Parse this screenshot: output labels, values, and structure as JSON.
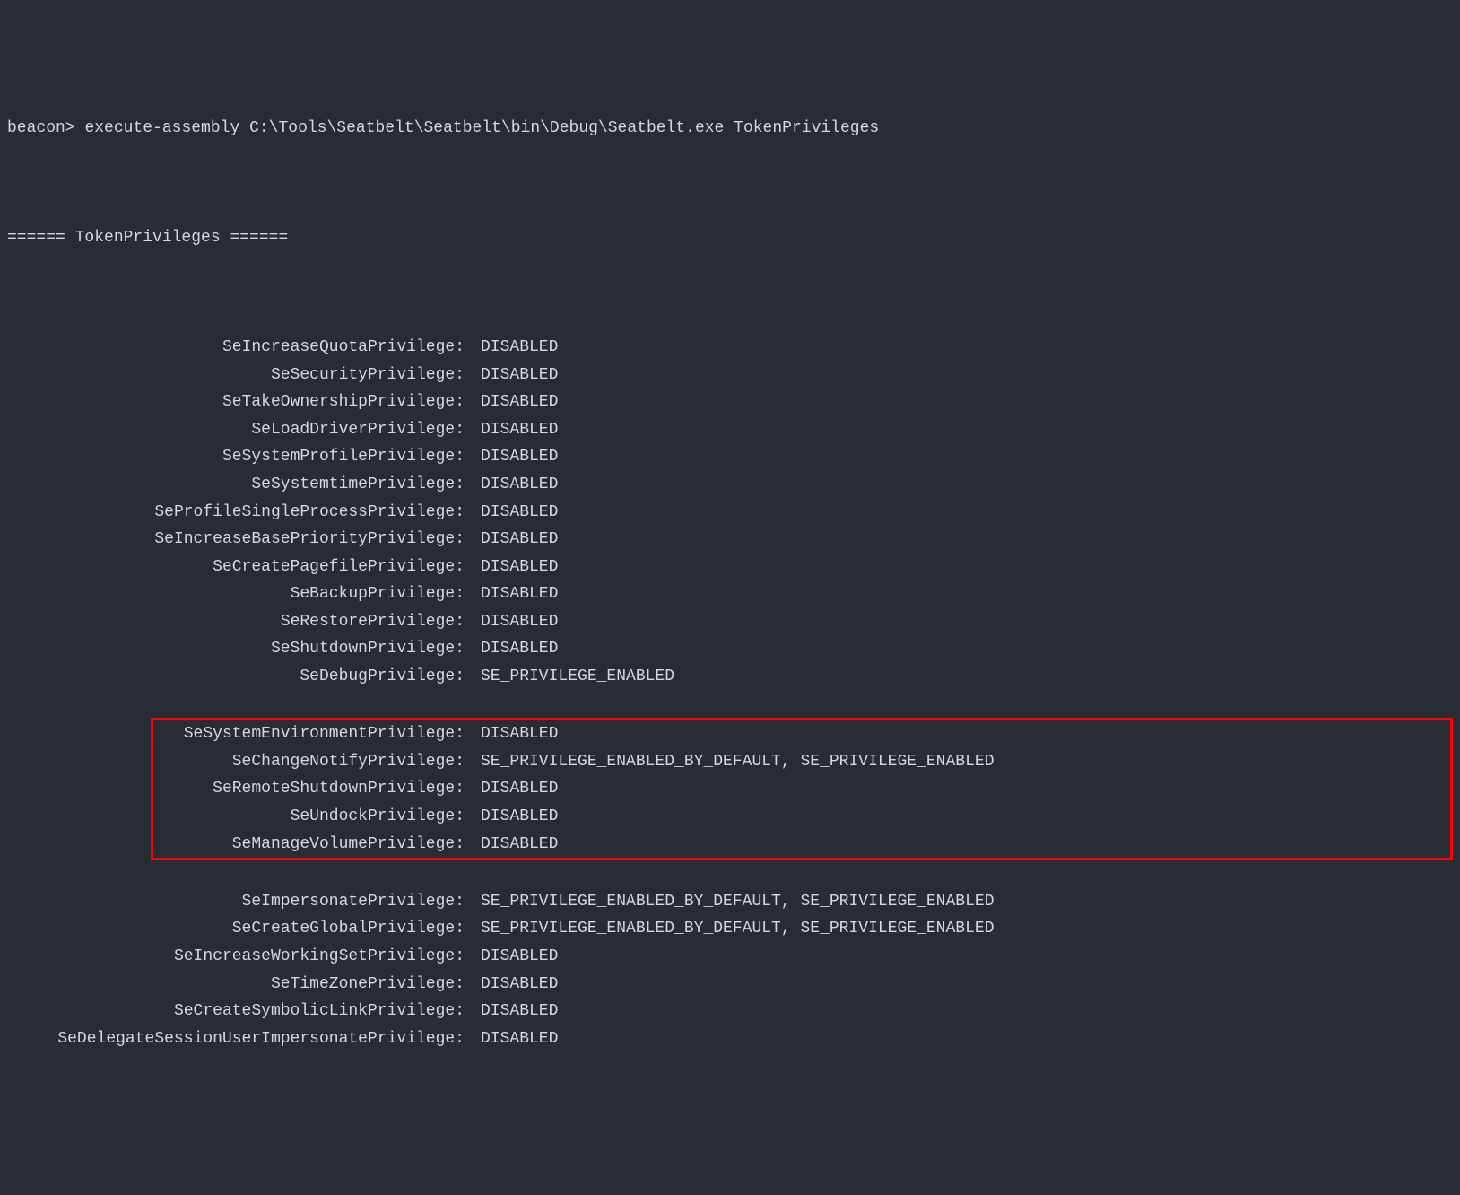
{
  "prompt_label": "beacon>",
  "command": "execute-assembly C:\\Tools\\Seatbelt\\Seatbelt\\bin\\Debug\\Seatbelt.exe TokenPrivileges",
  "section_header": "====== TokenPrivileges ======",
  "privileges_before": [
    {
      "name": "SeIncreaseQuotaPrivilege:",
      "value": "DISABLED"
    },
    {
      "name": "SeSecurityPrivilege:",
      "value": "DISABLED"
    },
    {
      "name": "SeTakeOwnershipPrivilege:",
      "value": "DISABLED"
    },
    {
      "name": "SeLoadDriverPrivilege:",
      "value": "DISABLED"
    },
    {
      "name": "SeSystemProfilePrivilege:",
      "value": "DISABLED"
    },
    {
      "name": "SeSystemtimePrivilege:",
      "value": "DISABLED"
    },
    {
      "name": "SeProfileSingleProcessPrivilege:",
      "value": "DISABLED"
    },
    {
      "name": "SeIncreaseBasePriorityPrivilege:",
      "value": "DISABLED"
    },
    {
      "name": "SeCreatePagefilePrivilege:",
      "value": "DISABLED"
    },
    {
      "name": "SeBackupPrivilege:",
      "value": "DISABLED"
    },
    {
      "name": "SeRestorePrivilege:",
      "value": "DISABLED"
    },
    {
      "name": "SeShutdownPrivilege:",
      "value": "DISABLED"
    },
    {
      "name": "SeDebugPrivilege:",
      "value": "SE_PRIVILEGE_ENABLED"
    }
  ],
  "privileges_highlighted": [
    {
      "name": "SeSystemEnvironmentPrivilege:",
      "value": "DISABLED"
    },
    {
      "name": "SeChangeNotifyPrivilege:",
      "value": "SE_PRIVILEGE_ENABLED_BY_DEFAULT, SE_PRIVILEGE_ENABLED"
    },
    {
      "name": "SeRemoteShutdownPrivilege:",
      "value": "DISABLED"
    },
    {
      "name": "SeUndockPrivilege:",
      "value": "DISABLED"
    },
    {
      "name": "SeManageVolumePrivilege:",
      "value": "DISABLED"
    }
  ],
  "privileges_after": [
    {
      "name": "SeImpersonatePrivilege:",
      "value": "SE_PRIVILEGE_ENABLED_BY_DEFAULT, SE_PRIVILEGE_ENABLED"
    },
    {
      "name": "SeCreateGlobalPrivilege:",
      "value": "SE_PRIVILEGE_ENABLED_BY_DEFAULT, SE_PRIVILEGE_ENABLED"
    },
    {
      "name": "SeIncreaseWorkingSetPrivilege:",
      "value": "DISABLED"
    },
    {
      "name": "SeTimeZonePrivilege:",
      "value": "DISABLED"
    },
    {
      "name": "SeCreateSymbolicLinkPrivilege:",
      "value": "DISABLED"
    },
    {
      "name": "SeDelegateSessionUserImpersonatePrivilege:",
      "value": "DISABLED"
    }
  ]
}
